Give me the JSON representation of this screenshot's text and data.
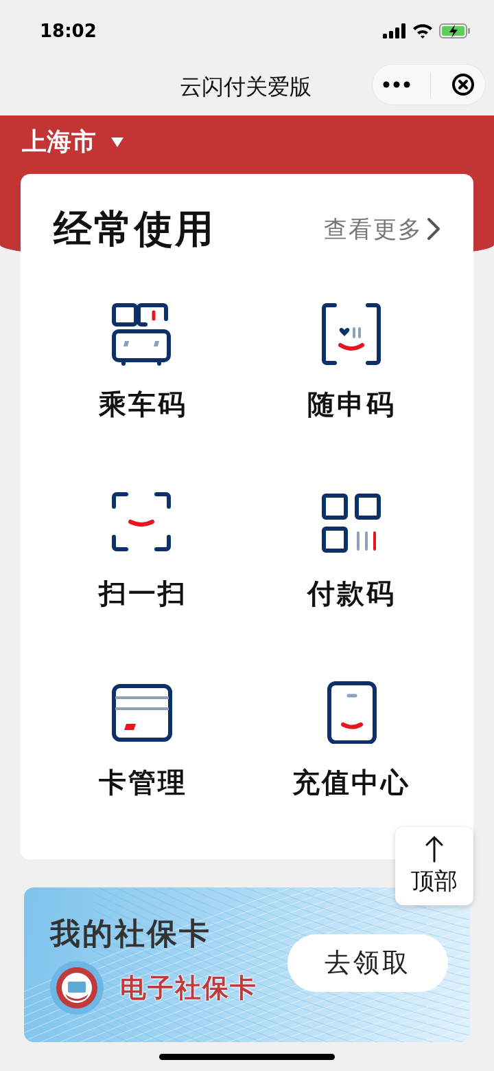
{
  "status_bar": {
    "time": "18:02"
  },
  "nav": {
    "title": "云闪付关爱版"
  },
  "city": {
    "label": "上海市"
  },
  "frequent": {
    "title": "经常使用",
    "more": "查看更多",
    "items": [
      {
        "label": "乘车码",
        "kind": "transit"
      },
      {
        "label": "随申码",
        "kind": "health"
      },
      {
        "label": "扫一扫",
        "kind": "scan"
      },
      {
        "label": "付款码",
        "kind": "pay"
      },
      {
        "label": "卡管理",
        "kind": "card"
      },
      {
        "label": "充值中心",
        "kind": "topup"
      }
    ]
  },
  "back_to_top": {
    "label": "顶部"
  },
  "social_card": {
    "title": "我的社保卡",
    "subtitle": "电子社保卡",
    "button": "去领取"
  }
}
